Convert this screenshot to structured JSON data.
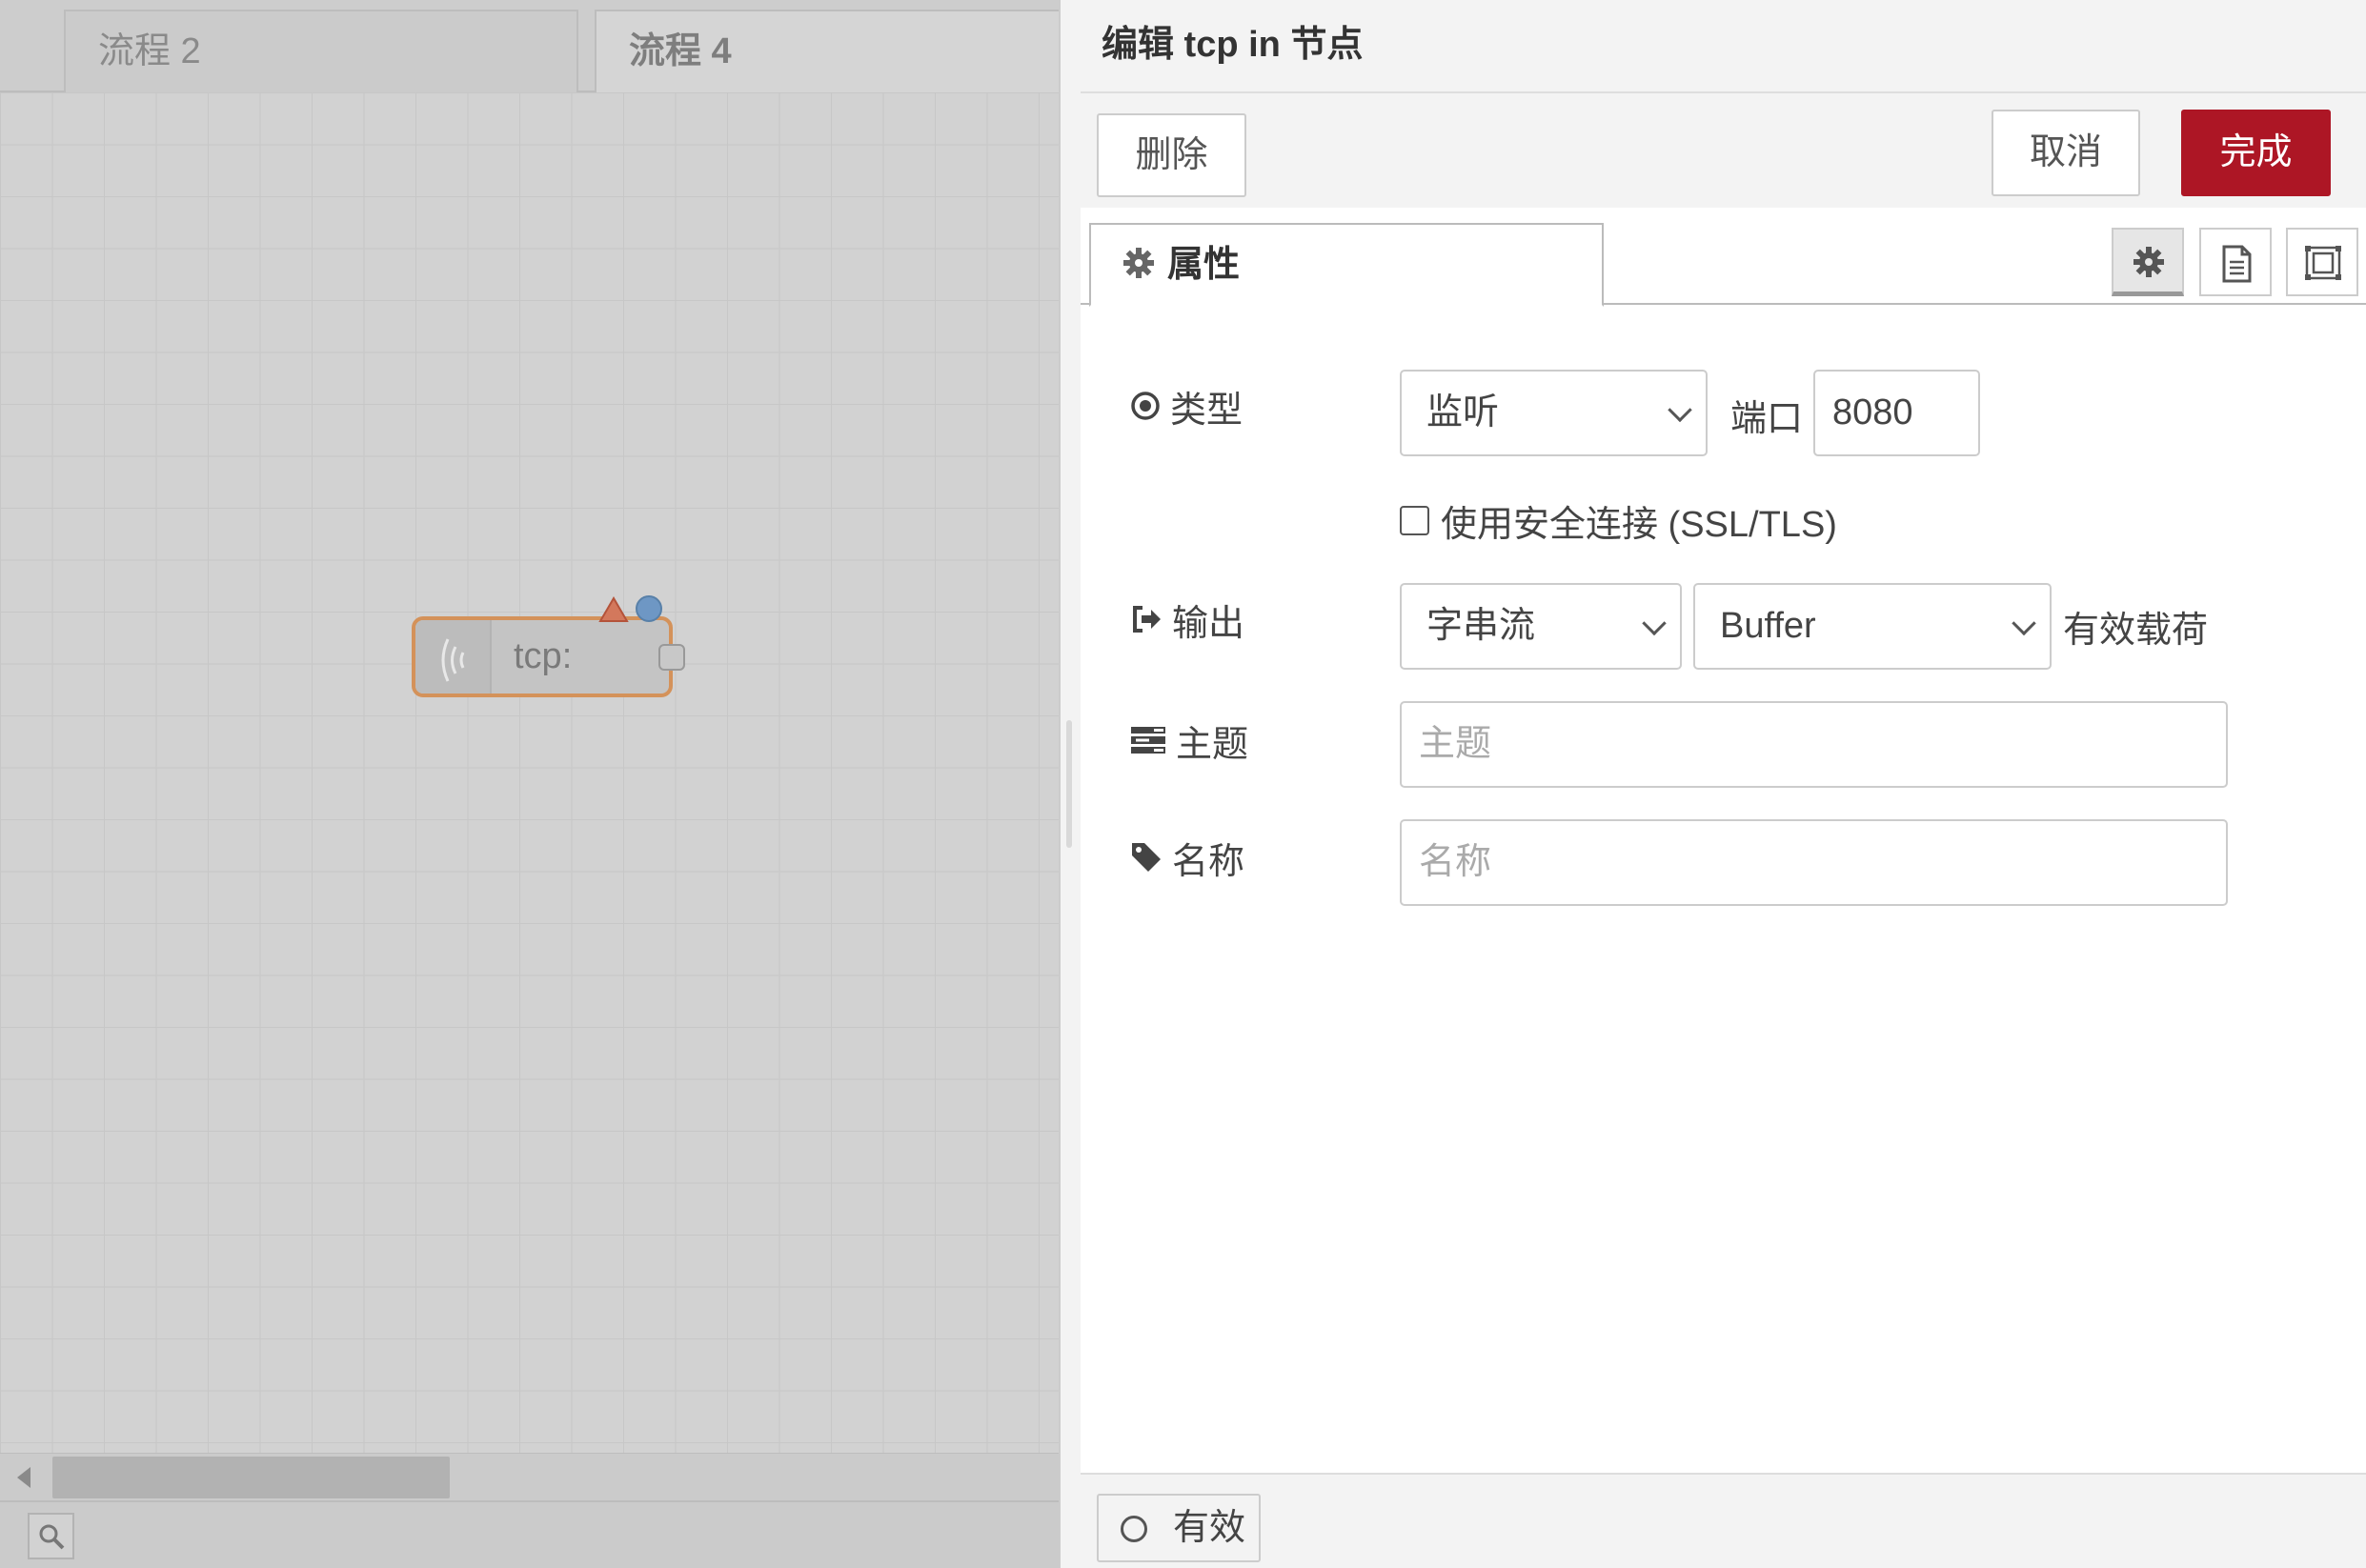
{
  "workspace": {
    "tabs": [
      {
        "label": "流程 2"
      },
      {
        "label": "流程 4"
      }
    ],
    "node": {
      "label": "tcp:"
    }
  },
  "tray": {
    "title": "编辑 tcp in 节点",
    "buttons": {
      "delete": "删除",
      "cancel": "取消",
      "done": "完成"
    },
    "tab_properties": "属性",
    "form": {
      "type_label": "类型",
      "type_value": "监听",
      "port_label": "端口",
      "port_value": "8080",
      "ssl_label": "使用安全连接 (SSL/TLS)",
      "output_label": "输出",
      "output_mode": "字串流",
      "output_format": "Buffer",
      "output_suffix": "有效载荷",
      "topic_label": "主题",
      "topic_placeholder": "主题",
      "name_label": "名称",
      "name_placeholder": "名称"
    },
    "footer": {
      "enabled_label": "有效"
    }
  },
  "colors": {
    "done_button": "#ad1625",
    "node_border": "#d4925a",
    "changed_dot": "#6e97c4",
    "warning": "#c8573a"
  },
  "icons": [
    "wifi-icon",
    "warning-icon",
    "gear-icon",
    "file-icon",
    "frame-icon",
    "dot-circle-icon",
    "sign-out-icon",
    "tasks-icon",
    "tag-icon",
    "search-icon",
    "chevron-down-icon"
  ]
}
